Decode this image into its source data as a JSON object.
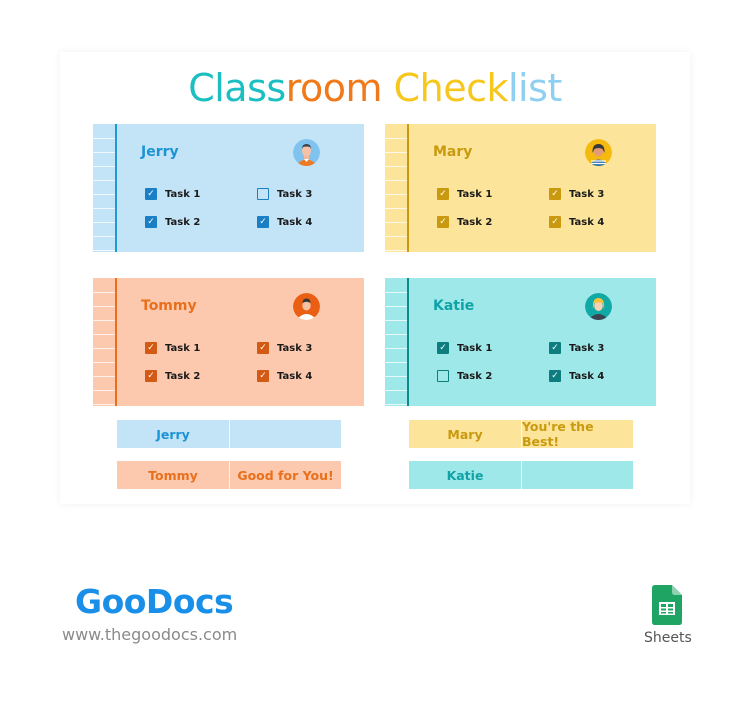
{
  "title": {
    "parts": [
      {
        "text": "Class",
        "color": "#1bbfc2"
      },
      {
        "text": "room",
        "color": "#f07a1a"
      },
      {
        "text": " Check",
        "color": "#f7c71e"
      },
      {
        "text": "list",
        "color": "#8fd0f2"
      }
    ]
  },
  "students": [
    {
      "name": "Jerry",
      "theme": {
        "bg": "#c3e3f7",
        "rule": "#1a9ad6",
        "name": "#1b93d4",
        "check": "#1a7fc4"
      },
      "tasks": [
        {
          "label": "Task 1",
          "checked": true
        },
        {
          "label": "Task 2",
          "checked": true
        },
        {
          "label": "Task 3",
          "checked": false
        },
        {
          "label": "Task 4",
          "checked": true
        }
      ]
    },
    {
      "name": "Mary",
      "theme": {
        "bg": "#fce49a",
        "rule": "#c99a10",
        "name": "#c99a10",
        "check": "#c99a10"
      },
      "tasks": [
        {
          "label": "Task 1",
          "checked": true
        },
        {
          "label": "Task 2",
          "checked": true
        },
        {
          "label": "Task 3",
          "checked": true
        },
        {
          "label": "Task 4",
          "checked": true
        }
      ]
    },
    {
      "name": "Tommy",
      "theme": {
        "bg": "#fdc9ae",
        "rule": "#e8701c",
        "name": "#e8701c",
        "check": "#d25a14"
      },
      "tasks": [
        {
          "label": "Task 1",
          "checked": true
        },
        {
          "label": "Task 2",
          "checked": true
        },
        {
          "label": "Task 3",
          "checked": true
        },
        {
          "label": "Task 4",
          "checked": true
        }
      ]
    },
    {
      "name": "Katie",
      "theme": {
        "bg": "#9fe8ea",
        "rule": "#0f8a8c",
        "name": "#0fa3a6",
        "check": "#0e7d80"
      },
      "tasks": [
        {
          "label": "Task 1",
          "checked": true
        },
        {
          "label": "Task 2",
          "checked": false
        },
        {
          "label": "Task 3",
          "checked": true
        },
        {
          "label": "Task 4",
          "checked": true
        }
      ]
    }
  ],
  "summary": [
    {
      "name": "Jerry",
      "message": "",
      "bg": "#c3e3f7",
      "color": "#1b93d4"
    },
    {
      "name": "Mary",
      "message": "You're the Best!",
      "bg": "#fce49a",
      "color": "#c99a10"
    },
    {
      "name": "Tommy",
      "message": "Good for You!",
      "bg": "#fdc9ae",
      "color": "#e8701c"
    },
    {
      "name": "Katie",
      "message": "",
      "bg": "#9fe8ea",
      "color": "#0fa3a6"
    }
  ],
  "footer": {
    "brand": "GooDocs",
    "url": "www.thegoodocs.com",
    "app_label": "Sheets",
    "app_icon": "google-sheets-icon"
  }
}
